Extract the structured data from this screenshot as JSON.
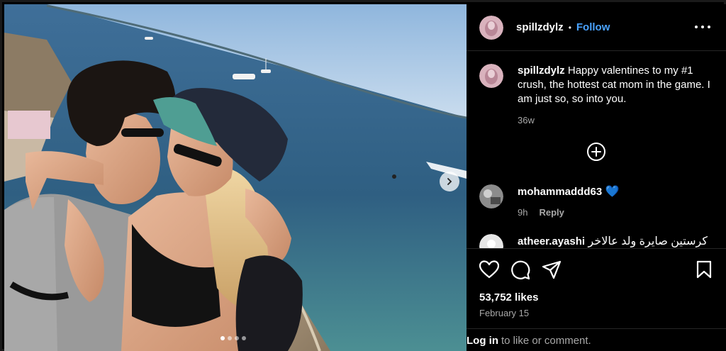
{
  "post": {
    "username": "spillzdylz",
    "separator": "•",
    "follow_label": "Follow",
    "more_icon": "more-options-icon"
  },
  "caption": {
    "username": "spillzdylz",
    "text": "Happy valentines to my #1 crush, the hottest cat mom in the game. I am just so, so into you.",
    "time": "36w"
  },
  "load_more_icon": "plus-circle-icon",
  "comments": [
    {
      "username": "mohammaddd63",
      "text": "💙",
      "time": "9h",
      "reply_label": "Reply"
    },
    {
      "username": "atheer.ayashi",
      "text": "كرستين صايرة ولد عالاخر"
    }
  ],
  "actions": {
    "icons": [
      "heart-icon",
      "comment-icon",
      "share-icon",
      "bookmark-icon"
    ]
  },
  "likes": "53,752 likes",
  "date": "February 15",
  "login": {
    "link_label": "Log in",
    "rest_text": "to like or comment."
  },
  "carousel": {
    "total_slides": 4,
    "active_slide": 1
  },
  "colors": {
    "background": "#000000",
    "link": "#4aa3ff",
    "muted": "#a8a8a8",
    "divider": "#262626"
  }
}
